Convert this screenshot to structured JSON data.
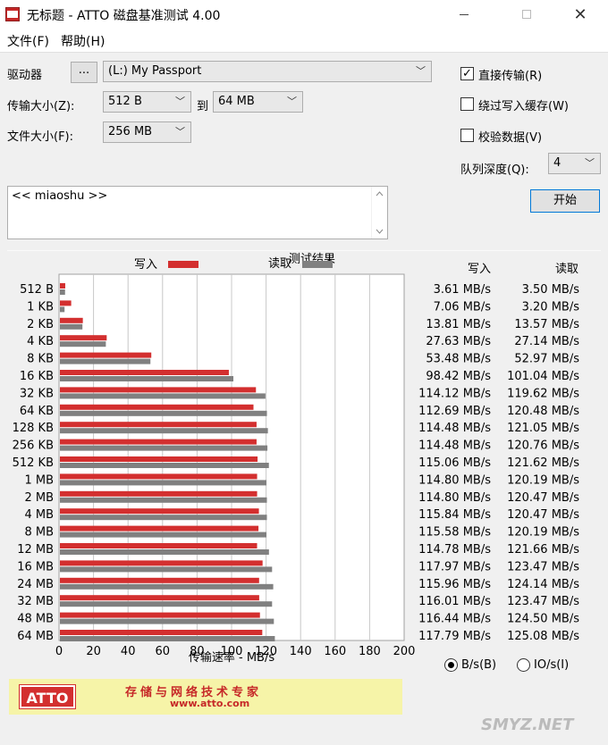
{
  "window": {
    "title": "无标题 - ATTO 磁盘基准测试 4.00",
    "close_glyph": "✕"
  },
  "menu": [
    "文件(F)",
    "帮助(H)"
  ],
  "form": {
    "drive_label": "驱动器",
    "browse_label": "...",
    "drive_value": "(L:) My Passport",
    "transfer_size_label": "传输大小(Z):",
    "transfer_from": "512 B",
    "to_label": "到",
    "transfer_to": "64 MB",
    "file_size_label": "文件大小(F):",
    "file_size": "256 MB",
    "direct_io_label": "直接传输(R)",
    "direct_io_checked": true,
    "bypass_cache_label": "绕过写入缓存(W)",
    "bypass_cache_checked": false,
    "verify_label": "校验数据(V)",
    "verify_checked": false,
    "queue_depth_label": "队列深度(Q):",
    "queue_depth": "4",
    "start_label": "开始",
    "description": "<< miaoshu >>",
    "check_glyph": "✓",
    "dropdown_glyph": "﹀"
  },
  "results": {
    "title": "测试结果",
    "write_header": "写入",
    "read_header": "读取",
    "unit_bps": "B/s(B)",
    "unit_iops": "IO/s(I)",
    "unit_selected": "B/s"
  },
  "chart_data": {
    "type": "bar",
    "orientation": "horizontal",
    "categories": [
      "512 B",
      "1 KB",
      "2 KB",
      "4 KB",
      "8 KB",
      "16 KB",
      "32 KB",
      "64 KB",
      "128 KB",
      "256 KB",
      "512 KB",
      "1 MB",
      "2 MB",
      "4 MB",
      "8 MB",
      "12 MB",
      "16 MB",
      "24 MB",
      "32 MB",
      "48 MB",
      "64 MB"
    ],
    "series": [
      {
        "name": "写入",
        "color": "#d32f2f",
        "values": [
          3.61,
          7.06,
          13.81,
          27.63,
          53.48,
          98.42,
          114.12,
          112.69,
          114.48,
          114.48,
          115.06,
          114.8,
          114.8,
          115.84,
          115.58,
          114.78,
          117.97,
          115.96,
          116.01,
          116.44,
          117.79
        ],
        "labels": [
          "3.61 MB/s",
          "7.06 MB/s",
          "13.81 MB/s",
          "27.63 MB/s",
          "53.48 MB/s",
          "98.42 MB/s",
          "114.12 MB/s",
          "112.69 MB/s",
          "114.48 MB/s",
          "114.48 MB/s",
          "115.06 MB/s",
          "114.80 MB/s",
          "114.80 MB/s",
          "115.84 MB/s",
          "115.58 MB/s",
          "114.78 MB/s",
          "117.97 MB/s",
          "115.96 MB/s",
          "116.01 MB/s",
          "116.44 MB/s",
          "117.79 MB/s"
        ]
      },
      {
        "name": "读取",
        "color": "#808080",
        "values": [
          3.5,
          3.2,
          13.57,
          27.14,
          52.97,
          101.04,
          119.62,
          120.48,
          121.05,
          120.76,
          121.62,
          120.19,
          120.47,
          120.47,
          120.19,
          121.66,
          123.47,
          124.14,
          123.47,
          124.5,
          125.08
        ],
        "labels": [
          "3.50 MB/s",
          "3.20 MB/s",
          "13.57 MB/s",
          "27.14 MB/s",
          "52.97 MB/s",
          "101.04 MB/s",
          "119.62 MB/s",
          "120.48 MB/s",
          "121.05 MB/s",
          "120.76 MB/s",
          "121.62 MB/s",
          "120.19 MB/s",
          "120.47 MB/s",
          "120.47 MB/s",
          "120.19 MB/s",
          "121.66 MB/s",
          "123.47 MB/s",
          "124.14 MB/s",
          "123.47 MB/s",
          "124.50 MB/s",
          "125.08 MB/s"
        ]
      }
    ],
    "xlim": [
      0,
      200
    ],
    "xticks": [
      0,
      20,
      40,
      60,
      80,
      100,
      120,
      140,
      160,
      180,
      200
    ],
    "xlabel": "传输速率 - MB/s",
    "grid": true,
    "legend": "top"
  },
  "banner": {
    "logo_text": "ATTO",
    "slogan": "存储与网络技术专家",
    "url": "www.atto.com"
  },
  "watermark": "SMYZ.NET"
}
